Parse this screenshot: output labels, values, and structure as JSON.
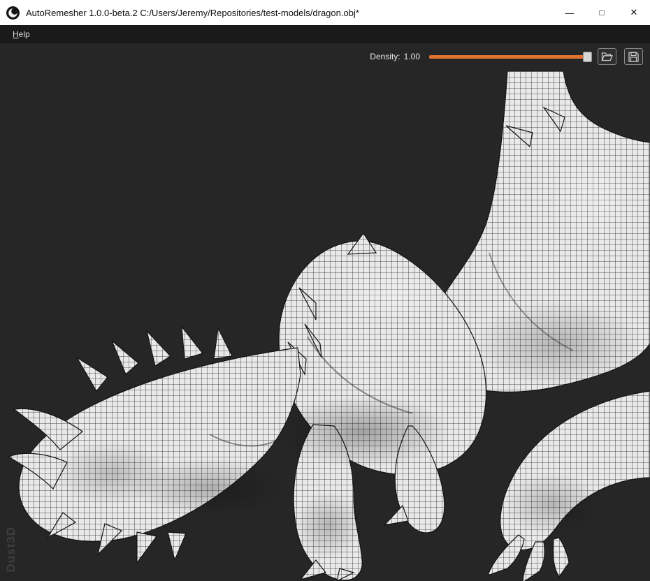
{
  "window": {
    "title": "AutoRemesher 1.0.0-beta.2 C:/Users/Jeremy/Repositories/test-models/dragon.obj*",
    "controls": {
      "minimize": "—",
      "maximize": "□",
      "close": "✕"
    }
  },
  "menu": {
    "items": [
      {
        "label": "Help",
        "mnemonic": "H",
        "rest": "elp"
      }
    ]
  },
  "toolbar": {
    "density_label": "Density:",
    "density_value": "1.00",
    "slider": {
      "min": 0,
      "max": 1,
      "value": 1.0,
      "position": "right-end"
    },
    "icons": {
      "open": "folder-open-icon",
      "save": "save-icon"
    }
  },
  "viewport": {
    "watermark": "Dust3D",
    "model_description": "quad-remeshed dragon wireframe mesh"
  },
  "colors": {
    "titlebar_bg": "#ffffff",
    "menubar_bg": "#1a1a1a",
    "viewport_bg": "#262626",
    "accent_orange": "#e0732f",
    "mesh_base": "#e9e9e9",
    "mesh_line": "#1f1f1f",
    "hud_text": "#eaeaea",
    "watermark_text": "#3e3e3e"
  }
}
